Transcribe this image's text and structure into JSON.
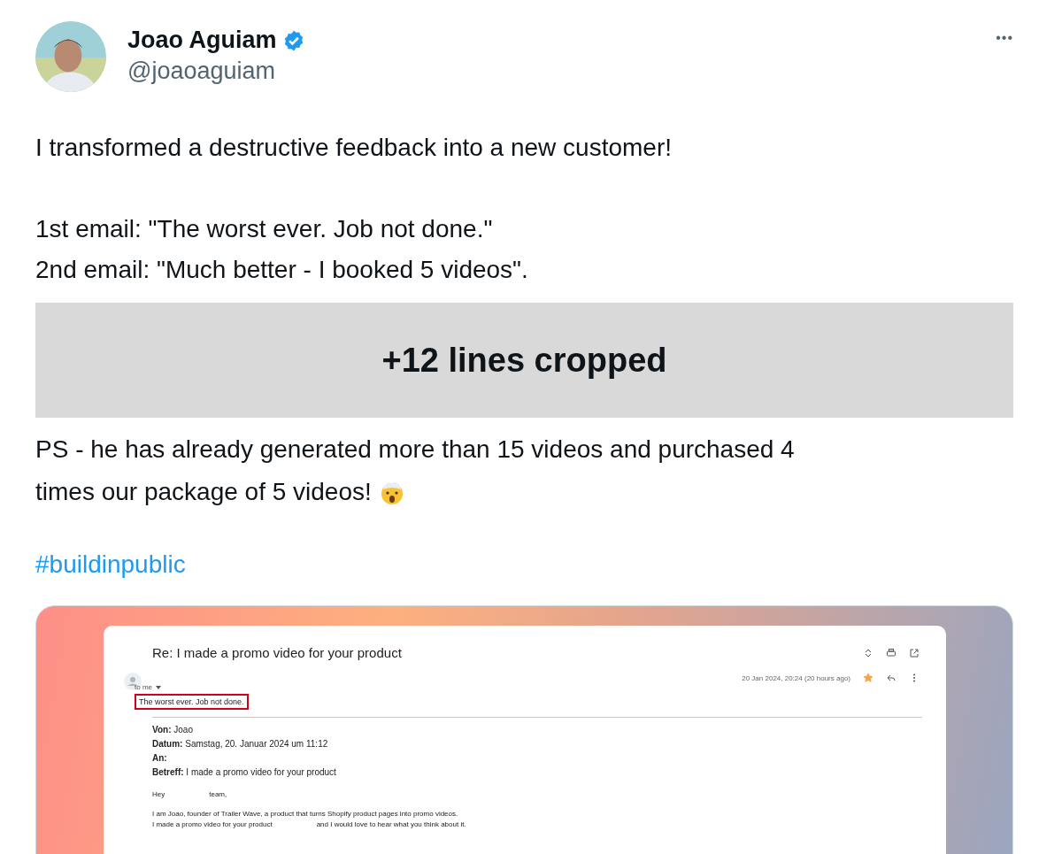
{
  "author": {
    "name": "Joao Aguiam",
    "verified": true,
    "handle": "@joaoaguiam"
  },
  "menu": "•••",
  "paragraphs": [
    [
      "I transformed a destructive feedback into a new customer!"
    ],
    [
      "1st email: \"The worst ever. Job not done.\"",
      "2nd email: \"Much better - I booked 5 videos\"."
    ]
  ],
  "cropped_notice": "+12 lines cropped",
  "ps": [
    "PS - he has already generated more than 15 videos and purchased 4",
    "times our package of 5 videos!"
  ],
  "hashtag": "#buildinpublic",
  "email": {
    "subject": "Re: I made a promo video for your product",
    "recipient": "to me",
    "date": "20 Jan 2024, 20:24 (20 hours ago)",
    "starred": true,
    "highlight": "The worst ever. Job not done.",
    "fields": [
      "**Von:** Joao",
      "**Datum:** Samstag, 20. Januar 2024 um 11:12",
      "**An:**",
      "**Betreff:** I made a promo video for your product"
    ],
    "greeting": [
      "Hey",
      "team,"
    ],
    "body": [
      [
        "I am Joao, founder of Trailer Wave, a product that turns Shopify product pages into promo videos."
      ],
      [
        "I made a promo video for your product",
        "and I would love to hear what you think about it."
      ]
    ]
  }
}
